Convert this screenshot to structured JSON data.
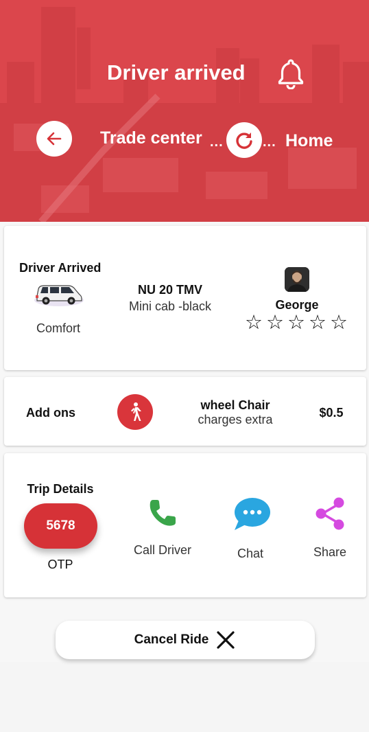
{
  "header": {
    "title": "Driver arrived",
    "from": "Trade center",
    "to": "Home",
    "separator": "...",
    "bg_color": "#d94047"
  },
  "ride": {
    "status_label": "Driver Arrived",
    "category": "Comfort",
    "plate": "NU 20 TMV",
    "model": "Mini cab -black",
    "driver_name": "George",
    "rating": 0,
    "rating_max": 5
  },
  "addons": {
    "label": "Add ons",
    "name": "wheel Chair",
    "note": "charges extra",
    "price": "$0.5"
  },
  "trip": {
    "label": "Trip Details",
    "otp_code": "5678",
    "otp_label": "OTP",
    "actions": [
      {
        "label": "Call Driver",
        "icon": "phone-icon",
        "color": "#3aa54a"
      },
      {
        "label": "Chat",
        "icon": "chat-bubble-icon",
        "color": "#2aa6e0"
      },
      {
        "label": "Share",
        "icon": "share-icon",
        "color": "#d54ae0"
      }
    ]
  },
  "cancel": {
    "label": "Cancel Ride"
  },
  "colors": {
    "accent": "#d63237"
  }
}
